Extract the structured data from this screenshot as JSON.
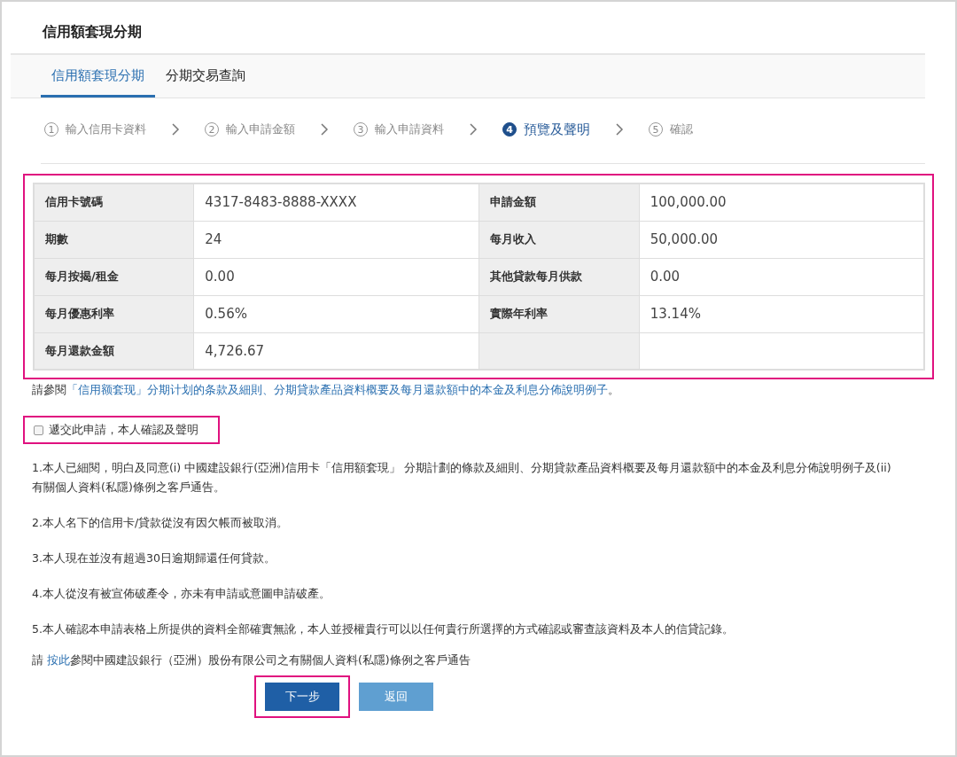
{
  "page_title": "信用額套現分期",
  "tabs": [
    {
      "label": "信用額套現分期",
      "selected": true
    },
    {
      "label": "分期交易查詢",
      "selected": false
    }
  ],
  "steps": [
    {
      "number": "1",
      "label": "輸入信用卡資料",
      "current": false
    },
    {
      "number": "2",
      "label": "輸入申請金額",
      "current": false
    },
    {
      "number": "3",
      "label": "輸入申請資料",
      "current": false
    },
    {
      "number": "4",
      "label": "預覽及聲明",
      "current": true
    },
    {
      "number": "5",
      "label": "確認",
      "current": false
    }
  ],
  "summary": {
    "highlighted": true,
    "rows": [
      [
        {
          "label": "信用卡號碼",
          "value": "4317-8483-8888-XXXX"
        },
        {
          "label": "申請金額",
          "value": "100,000.00"
        }
      ],
      [
        {
          "label": "期數",
          "value": "24"
        },
        {
          "label": "每月收入",
          "value": "50,000.00"
        }
      ],
      [
        {
          "label": "每月按揭/租金",
          "value": "0.00"
        },
        {
          "label": "其他貸款每月供款",
          "value": "0.00"
        }
      ],
      [
        {
          "label": "每月優惠利率",
          "value": "0.56%"
        },
        {
          "label": "實際年利率",
          "value": "13.14%"
        }
      ],
      [
        {
          "label": "每月還款金額",
          "value": "4,726.67"
        }
      ]
    ]
  },
  "reference": {
    "prefix": "請參閱",
    "link": "「信用额套现」分期计划的条款及細則、分期貸款產品資料概要及每月還款額中的本金及利息分佈說明例子",
    "suffix": "。"
  },
  "consent": {
    "label": "遞交此申請，本人確認及聲明",
    "checked": false,
    "highlighted": true
  },
  "terms": [
    "1.本人已細閱，明白及同意(i) 中國建設銀行(亞洲)信用卡「信用額套現」 分期計劃的條款及細則、分期貸款產品資料概要及每月還款額中的本金及利息分佈說明例子及(ii) 有關個人資料(私隱)條例之客戶通告。",
    "2.本人名下的信用卡/貸款從沒有因欠帳而被取消。",
    "3.本人現在並沒有超過30日逾期歸還任何貸款。",
    "4.本人從沒有被宣佈破產令，亦未有申請或意圖申請破產。",
    "5.本人確認本申請表格上所提供的資料全部確實無訛，本人並授權貴行可以以任何貴行所選擇的方式確認或審查該資料及本人的信貸記錄。"
  ],
  "notice": {
    "prefix": "請 ",
    "link": "按此",
    "suffix": "參閱中國建設銀行（亞洲）股份有限公司之有關個人資料(私隱)條例之客戶通告"
  },
  "buttons": [
    {
      "label": "下一步",
      "kind": "primary",
      "highlighted": true
    },
    {
      "label": "返回",
      "kind": "secondary",
      "highlighted": false
    }
  ]
}
